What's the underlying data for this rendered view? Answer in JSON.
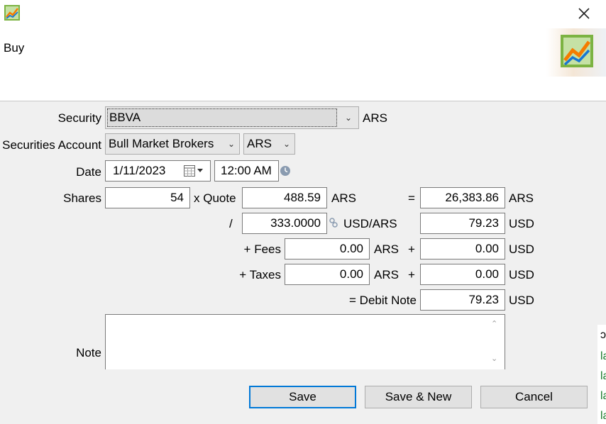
{
  "window": {
    "title": "Buy",
    "icons": {
      "app": "chart-trend-icon",
      "close": "close-icon",
      "banner": "chart-trend-icon"
    }
  },
  "form": {
    "security": {
      "label": "Security",
      "value": "BBVA",
      "currency": "ARS"
    },
    "account": {
      "label": "Securities Account",
      "value": "Bull Market Brokers",
      "currency": "ARS"
    },
    "date": {
      "label": "Date",
      "value": "1/11/2023",
      "time": "12:00 AM"
    },
    "shares": {
      "label": "Shares",
      "value": "54",
      "quote_label": "x Quote",
      "quote": "488.59",
      "quote_currency": "ARS",
      "equals": "=",
      "total": "26,383.86",
      "total_currency": "ARS"
    },
    "exchange": {
      "operator": "/",
      "rate": "333.0000",
      "rate_unit": "USD/ARS",
      "converted": "79.23",
      "converted_currency": "USD"
    },
    "fees": {
      "label": "+ Fees",
      "value": "0.00",
      "currency": "ARS",
      "plus": "+",
      "converted": "0.00",
      "converted_currency": "USD"
    },
    "taxes": {
      "label": "+ Taxes",
      "value": "0.00",
      "currency": "ARS",
      "plus": "+",
      "converted": "0.00",
      "converted_currency": "USD"
    },
    "debit": {
      "label": "= Debit Note",
      "value": "79.23",
      "currency": "USD"
    },
    "note": {
      "label": "Note",
      "value": ""
    }
  },
  "buttons": {
    "save": "Save",
    "save_new": "Save & New",
    "cancel": "Cancel"
  },
  "background_edge": [
    "ɔ",
    "la",
    "la",
    "la",
    "la"
  ],
  "colors": {
    "accent": "#0078d7",
    "edge_text": "#1a7a2a"
  }
}
